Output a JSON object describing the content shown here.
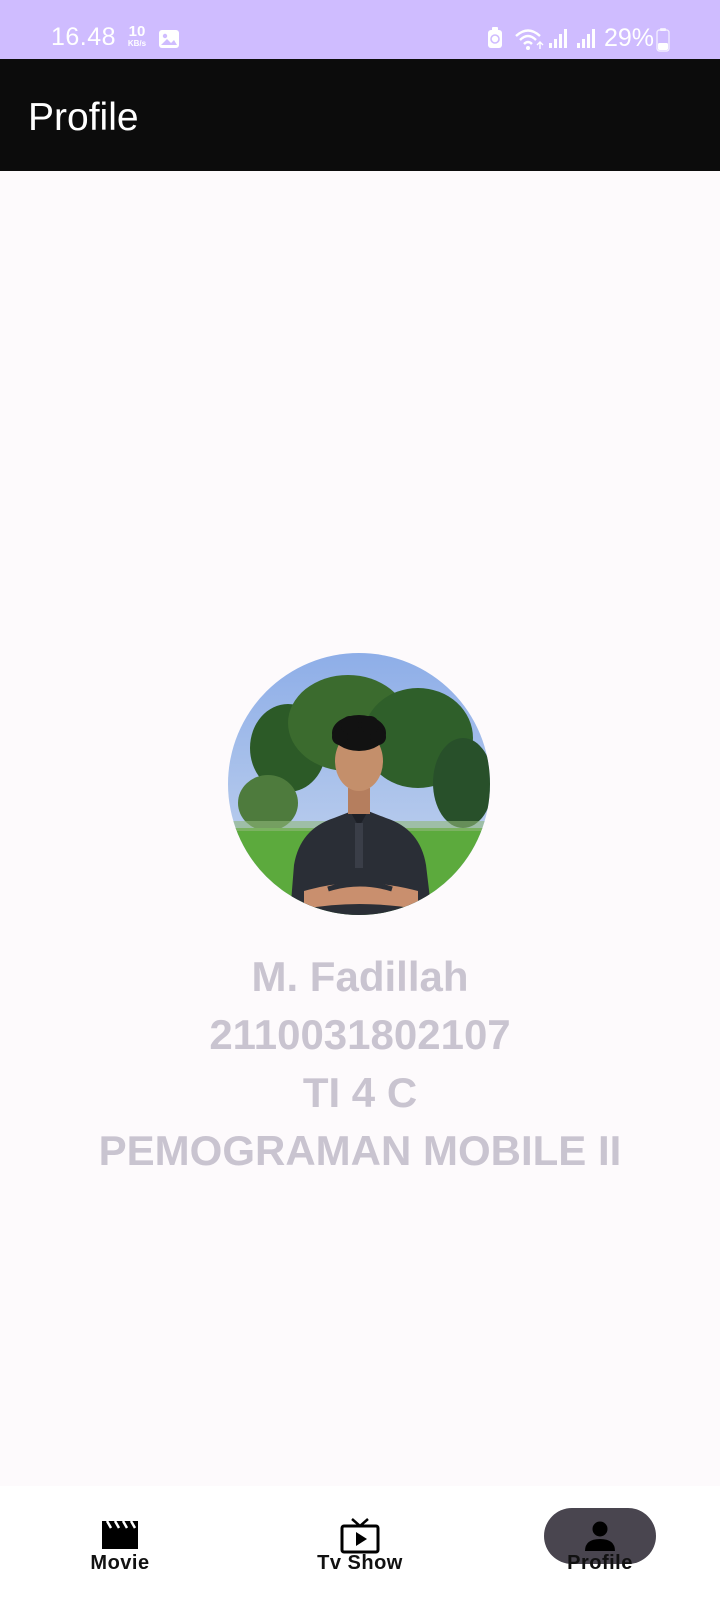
{
  "status_bar": {
    "time": "16.48",
    "net_speed_value": "10",
    "net_speed_unit": "KB/s",
    "battery": "29%",
    "icons": [
      "gallery-icon",
      "alarm-icon",
      "wifi-icon",
      "signal-icon",
      "signal-icon",
      "battery-icon"
    ]
  },
  "app_bar": {
    "title": "Profile"
  },
  "profile": {
    "name": "M. Fadillah",
    "id": "2110031802107",
    "class": "TI 4 C",
    "course": "PEMOGRAMAN MOBILE II"
  },
  "bottom_nav": {
    "items": [
      {
        "label": "Movie",
        "icon": "clapperboard-icon"
      },
      {
        "label": "Tv Show",
        "icon": "tv-play-icon"
      },
      {
        "label": "Profile",
        "icon": "person-icon",
        "selected": true
      }
    ]
  },
  "colors": {
    "status_bar": "#cfbcff",
    "app_bar": "#0c0c0c",
    "background": "#fdfafc",
    "profile_text": "#c9c4d0",
    "nav_selected_pill": "#49454f"
  }
}
